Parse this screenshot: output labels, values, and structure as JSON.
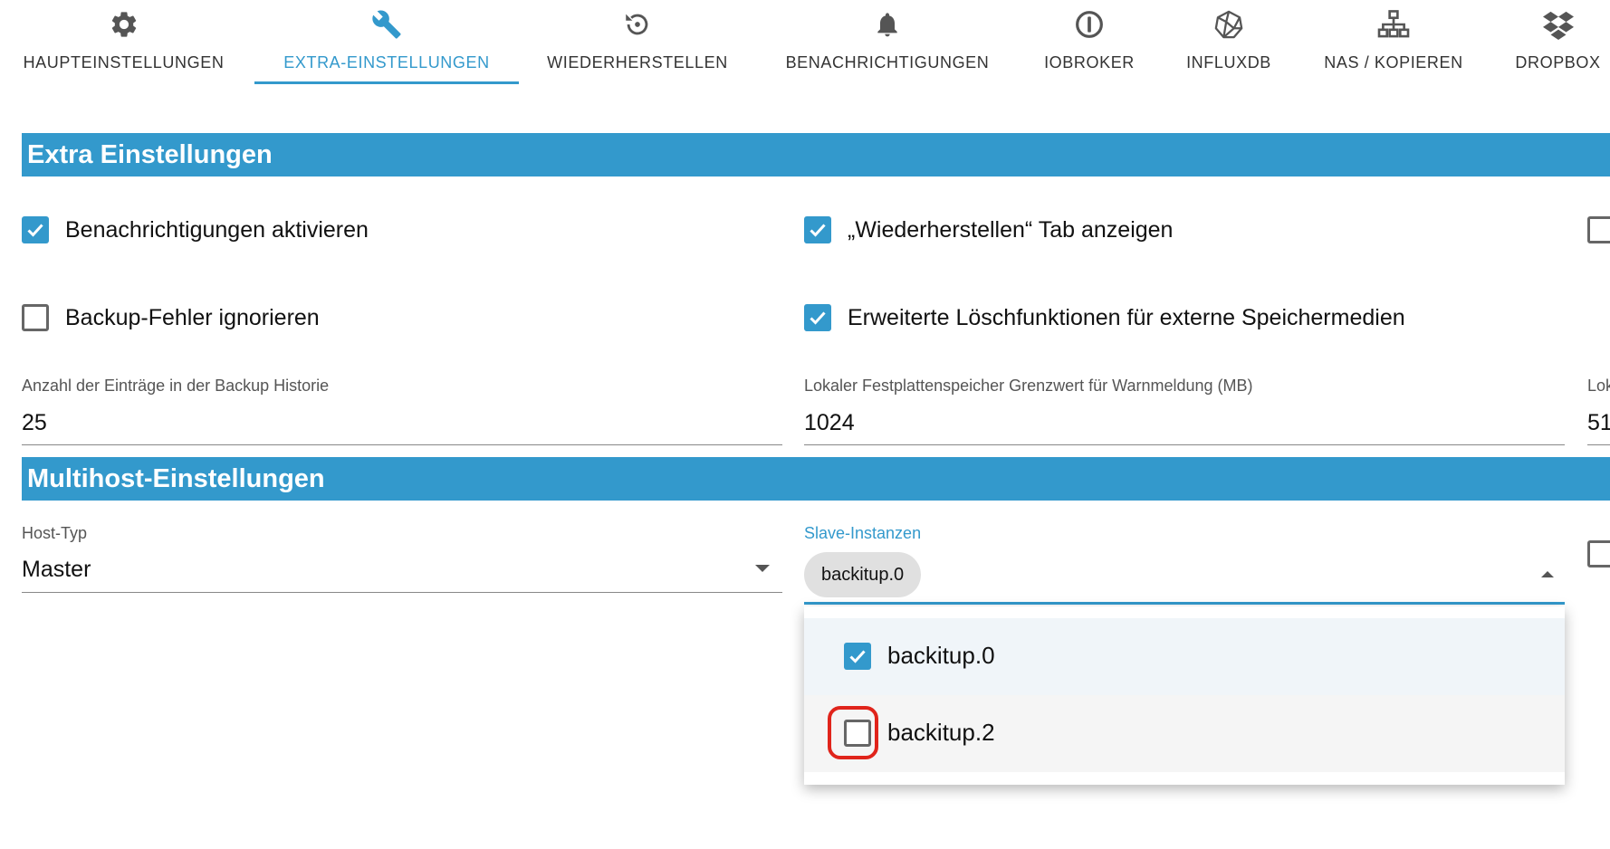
{
  "tabs": [
    {
      "label": "HAUPTEINSTELLUNGEN",
      "icon": "gear-icon",
      "active": false
    },
    {
      "label": "EXTRA-EINSTELLUNGEN",
      "icon": "wrench-icon",
      "active": true
    },
    {
      "label": "WIEDERHERSTELLEN",
      "icon": "restore-icon",
      "active": false
    },
    {
      "label": "BENACHRICHTIGUNGEN",
      "icon": "bell-icon",
      "active": false
    },
    {
      "label": "IOBROKER",
      "icon": "iobroker-icon",
      "active": false
    },
    {
      "label": "INFLUXDB",
      "icon": "influxdb-icon",
      "active": false
    },
    {
      "label": "NAS / KOPIEREN",
      "icon": "network-icon",
      "active": false
    },
    {
      "label": "DROPBOX",
      "icon": "dropbox-icon",
      "active": false
    }
  ],
  "extra": {
    "title": "Extra Einstellungen",
    "notifications": {
      "label": "Benachrichtigungen aktivieren",
      "checked": true
    },
    "restore_tab": {
      "label": "„Wiederherstellen“ Tab anzeigen",
      "checked": true
    },
    "ignore_errors": {
      "label": "Backup-Fehler ignorieren",
      "checked": false
    },
    "extended_delete": {
      "label": "Erweiterte Löschfunktionen für externe Speichermedien",
      "checked": true
    },
    "third_col_checkbox": {
      "checked": false
    },
    "history": {
      "label": "Anzahl der Einträge in der Backup Historie",
      "value": "25"
    },
    "disk_limit": {
      "label": "Lokaler Festplattenspeicher Grenzwert für Warnmeldung (MB)",
      "value": "1024"
    },
    "third_field": {
      "label": "Lok",
      "value": "51"
    }
  },
  "multihost": {
    "title": "Multihost-Einstellungen",
    "host_type": {
      "label": "Host-Typ",
      "value": "Master"
    },
    "slaves": {
      "label": "Slave-Instanzen",
      "chips": [
        "backitup.0"
      ],
      "options": [
        {
          "label": "backitup.0",
          "checked": true
        },
        {
          "label": "backitup.2",
          "checked": false
        }
      ]
    },
    "third_checkbox": {
      "checked": false
    }
  },
  "colors": {
    "accent": "#3399cc",
    "highlight": "#e0241b"
  }
}
